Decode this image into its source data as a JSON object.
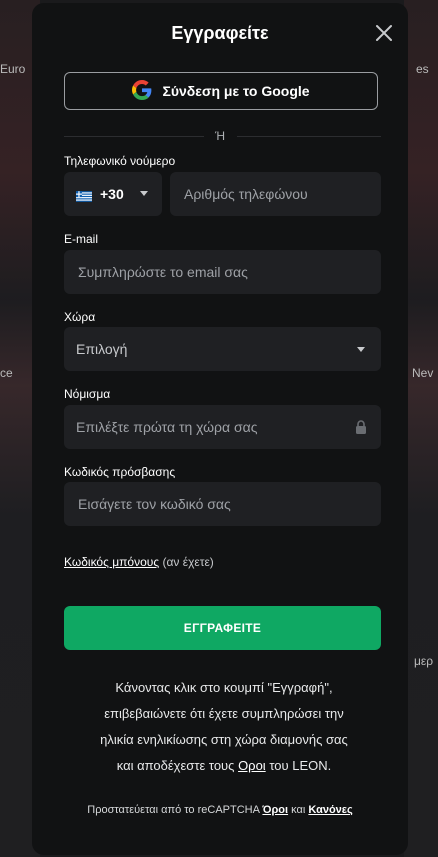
{
  "modal": {
    "title": "Εγγραφείτε",
    "google_label": "Σύνδεση με το Google",
    "or_label": "Ή",
    "phone": {
      "label": "Τηλεφωνικό νούμερο",
      "code": "+30",
      "placeholder": "Αριθμός τηλεφώνου"
    },
    "email": {
      "label": "E-mail",
      "placeholder": "Συμπληρώστε το email σας"
    },
    "country": {
      "label": "Χώρα",
      "selected": "Επιλογή"
    },
    "currency": {
      "label": "Νόμισμα",
      "placeholder": "Επιλέξτε πρώτα τη χώρα σας"
    },
    "password": {
      "label": "Κωδικός πρόσβασης",
      "placeholder": "Εισάγετε τον κωδικό σας"
    },
    "bonus": {
      "link": "Κωδικός μπόνους",
      "suffix": "(αν έχετε)"
    },
    "submit_label": "ΕΓΓΡΑΦΕΙΤΕ",
    "terms": {
      "line1": "Κάνοντας κλικ στο κουμπί \"Εγγραφή\",",
      "line2": "επιβεβαιώνετε ότι έχετε συμπληρώσει την",
      "line3": "ηλικία ενηλικίωσης στη χώρα διαμονής σας",
      "line4_pre": "και αποδέχεστε τους",
      "line4_link": "Οροι",
      "line4_post": "του LEON."
    },
    "captcha": {
      "prefix": "Προστατεύεται από το reCAPTCHA",
      "terms_link": "Όροι",
      "and": "και",
      "rules_link": "Κανόνες"
    }
  },
  "background": {
    "left_texts": [
      "Euro",
      "ce"
    ],
    "right_texts": [
      "es",
      "Nev"
    ],
    "bottom_right_text": "μερ"
  },
  "colors": {
    "modal_bg": "#111213",
    "field_bg": "#1f2023",
    "accent_green": "#0fa863"
  }
}
